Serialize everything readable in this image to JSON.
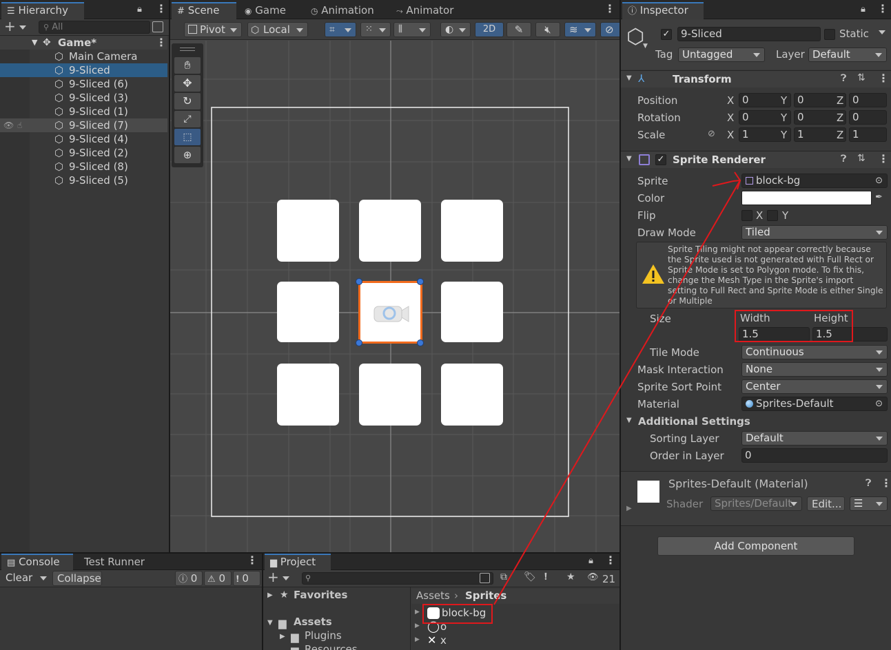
{
  "hierarchy": {
    "tab_label": "Hierarchy",
    "search_placeholder": "All",
    "scene_name": "Game*",
    "items": [
      {
        "label": "Main Camera"
      },
      {
        "label": "9-Sliced"
      },
      {
        "label": "9-Sliced (6)"
      },
      {
        "label": "9-Sliced (3)"
      },
      {
        "label": "9-Sliced (1)"
      },
      {
        "label": "9-Sliced (7)"
      },
      {
        "label": "9-Sliced (4)"
      },
      {
        "label": "9-Sliced (2)"
      },
      {
        "label": "9-Sliced (8)"
      },
      {
        "label": "9-Sliced (5)"
      }
    ]
  },
  "scene_tabs": {
    "scene": "Scene",
    "game": "Game",
    "animation": "Animation",
    "animator": "Animator"
  },
  "scene_toolbar": {
    "pivot": "Pivot",
    "local": "Local",
    "mode_2d": "2D"
  },
  "inspector": {
    "tab_label": "Inspector",
    "object_name": "9-Sliced",
    "static_label": "Static",
    "tag_label": "Tag",
    "tag_value": "Untagged",
    "layer_label": "Layer",
    "layer_value": "Default",
    "transform": {
      "title": "Transform",
      "position_label": "Position",
      "rotation_label": "Rotation",
      "scale_label": "Scale",
      "x_label": "X",
      "y_label": "Y",
      "z_label": "Z",
      "position": {
        "x": "0",
        "y": "0",
        "z": "0"
      },
      "rotation": {
        "x": "0",
        "y": "0",
        "z": "0"
      },
      "scale": {
        "x": "1",
        "y": "1",
        "z": "1"
      }
    },
    "sprite_renderer": {
      "title": "Sprite Renderer",
      "sprite_label": "Sprite",
      "sprite_value": "block-bg",
      "color_label": "Color",
      "color_value": "#ffffff",
      "flip_label": "Flip",
      "flip_x": "X",
      "flip_y": "Y",
      "draw_mode_label": "Draw Mode",
      "draw_mode_value": "Tiled",
      "warning_text": "Sprite Tiling might not appear correctly because the Sprite used is not generated with Full Rect or Sprite Mode is set to Polygon mode. To fix this, change the Mesh Type in the Sprite's import setting to Full Rect and Sprite Mode is either Single or Multiple",
      "size_label": "Size",
      "width_label": "Width",
      "height_label": "Height",
      "width_value": "1.5",
      "height_value": "1.5",
      "tile_mode_label": "Tile Mode",
      "tile_mode_value": "Continuous",
      "mask_interaction_label": "Mask Interaction",
      "mask_interaction_value": "None",
      "sort_point_label": "Sprite Sort Point",
      "sort_point_value": "Center",
      "material_label": "Material",
      "material_value": "Sprites-Default",
      "additional_settings_label": "Additional Settings",
      "sorting_layer_label": "Sorting Layer",
      "sorting_layer_value": "Default",
      "order_in_layer_label": "Order in Layer",
      "order_in_layer_value": "0"
    },
    "material": {
      "title": "Sprites-Default (Material)",
      "shader_label": "Shader",
      "shader_value": "Sprites/Default",
      "edit_label": "Edit..."
    },
    "add_component_label": "Add Component"
  },
  "console": {
    "tab_console": "Console",
    "tab_test_runner": "Test Runner",
    "clear_label": "Clear",
    "collapse_label": "Collapse",
    "info_count": "0",
    "warning_count": "0",
    "error_count": "0"
  },
  "project": {
    "tab_label": "Project",
    "favorites_label": "Favorites",
    "assets_label": "Assets",
    "plugins_label": "Plugins",
    "resources_label": "Resources",
    "breadcrumb_root": "Assets",
    "breadcrumb_current": "Sprites",
    "hidden_count": "21",
    "files": [
      {
        "label": "block-bg"
      },
      {
        "label": "o"
      },
      {
        "label": "x"
      }
    ]
  },
  "colors": {
    "selection": "#2c5d87",
    "accent_blue": "#3a79bb",
    "selection_orange": "#f26b1d",
    "annotation_red": "#e0181c",
    "scene_bg": "#474747"
  }
}
